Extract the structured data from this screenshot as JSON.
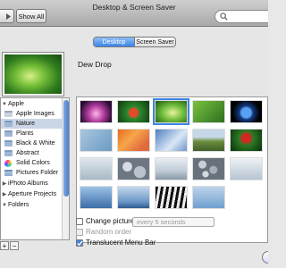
{
  "window": {
    "title": "Desktop & Screen Saver"
  },
  "toolbar": {
    "show_all": "Show All",
    "search_placeholder": ""
  },
  "tabs": [
    {
      "label": "Desktop",
      "active": true
    },
    {
      "label": "Screen Saver",
      "active": false
    }
  ],
  "current_wallpaper": {
    "name": "Dew Drop"
  },
  "sources": [
    {
      "label": "Apple",
      "kind": "group"
    },
    {
      "label": "Apple Images",
      "kind": "item"
    },
    {
      "label": "Nature",
      "kind": "item",
      "selected": true
    },
    {
      "label": "Plants",
      "kind": "item"
    },
    {
      "label": "Black & White",
      "kind": "item"
    },
    {
      "label": "Abstract",
      "kind": "item"
    },
    {
      "label": "Solid Colors",
      "kind": "item"
    },
    {
      "label": "Pictures Folder",
      "kind": "item"
    },
    {
      "label": "iPhoto Albums",
      "kind": "group"
    },
    {
      "label": "Aperture Projects",
      "kind": "group"
    },
    {
      "label": "Folders",
      "kind": "group"
    }
  ],
  "options": {
    "change_picture": "Change picture:",
    "interval": "every 5 seconds",
    "random_order": "Random order",
    "translucent_menu_bar": "Translucent Menu Bar"
  },
  "buttons": {
    "add": "+",
    "remove": "−"
  },
  "colors": {
    "accent": "#3c84e6",
    "selection": "#cad6e6"
  }
}
